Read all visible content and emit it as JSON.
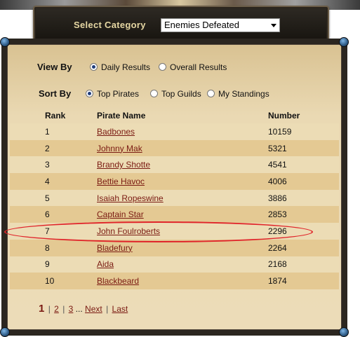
{
  "category": {
    "label": "Select Category",
    "selected": "Enemies Defeated"
  },
  "view_by": {
    "label": "View By",
    "options": [
      "Daily Results",
      "Overall Results"
    ],
    "selected_index": 0
  },
  "sort_by": {
    "label": "Sort By",
    "options": [
      "Top Pirates",
      "Top Guilds",
      "My Standings"
    ],
    "selected_index": 0
  },
  "table": {
    "headers": [
      "Rank",
      "Pirate Name",
      "Number"
    ],
    "rows": [
      {
        "rank": "1",
        "name": "Badbones",
        "number": "10159"
      },
      {
        "rank": "2",
        "name": "Johnny Mak",
        "number": "5321"
      },
      {
        "rank": "3",
        "name": "Brandy Shotte",
        "number": "4541"
      },
      {
        "rank": "4",
        "name": "Bettie Havoc",
        "number": "4006"
      },
      {
        "rank": "5",
        "name": "Isaiah Ropeswine",
        "number": "3886"
      },
      {
        "rank": "6",
        "name": "Captain Star",
        "number": "2853"
      },
      {
        "rank": "7",
        "name": "John Foulroberts",
        "number": "2296"
      },
      {
        "rank": "8",
        "name": "Bladefury",
        "number": "2264"
      },
      {
        "rank": "9",
        "name": "Aida",
        "number": "2168"
      },
      {
        "rank": "10",
        "name": "Blackbeard",
        "number": "1874"
      }
    ],
    "highlighted_rank": "7",
    "highlight_color": "#e0242a"
  },
  "pager": {
    "current": "1",
    "pages": [
      "2",
      "3"
    ],
    "ellipsis": "...",
    "next": "Next",
    "last": "Last",
    "separator": "|"
  },
  "colors": {
    "link": "#7a1a12",
    "row_light": "#ecdcb5",
    "row_dark": "#e4c993"
  }
}
